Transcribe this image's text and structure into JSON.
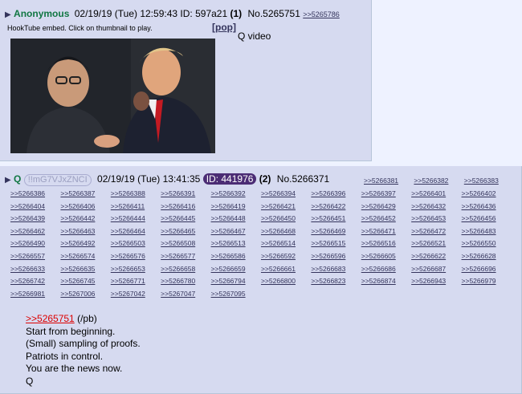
{
  "post1": {
    "name": "Anonymous",
    "date": "02/19/19 (Tue) 12:59:43",
    "id_label": "ID:",
    "id_value": "597a21",
    "id_count": "(1)",
    "number": "No.5265751",
    "reply_link": ">>5265786",
    "embed_note": "HookTube embed. Click on thumbnail to play.",
    "pop_label": "[pop]",
    "video_label": "Q video"
  },
  "post2": {
    "name": "Q",
    "tripcode": "!!mG7VJxZNCI",
    "date": "02/19/19 (Tue) 13:41:35",
    "id_badge": "ID: 441976",
    "id_count": "(2)",
    "number": "No.5266371",
    "first_row_links": [
      ">>5266381",
      ">>5266382",
      ">>5266383"
    ],
    "backlinks": [
      ">>5266386",
      ">>5266387",
      ">>5266388",
      ">>5266391",
      ">>5266392",
      ">>5266394",
      ">>5266396",
      ">>5266397",
      ">>5266401",
      ">>5266402",
      ">>5266404",
      ">>5266406",
      ">>5266411",
      ">>5266416",
      ">>5266419",
      ">>5266421",
      ">>5266422",
      ">>5266429",
      ">>5266432",
      ">>5266436",
      ">>5266439",
      ">>5266442",
      ">>5266444",
      ">>5266445",
      ">>5266448",
      ">>5266450",
      ">>5266451",
      ">>5266452",
      ">>5266453",
      ">>5266456",
      ">>5266462",
      ">>5266463",
      ">>5266464",
      ">>5266465",
      ">>5266467",
      ">>5266468",
      ">>5266469",
      ">>5266471",
      ">>5266472",
      ">>5266483",
      ">>5266490",
      ">>5266492",
      ">>5266503",
      ">>5266508",
      ">>5266513",
      ">>5266514",
      ">>5266515",
      ">>5266516",
      ">>5266521",
      ">>5266550",
      ">>5266557",
      ">>5266574",
      ">>5266576",
      ">>5266577",
      ">>5266586",
      ">>5266592",
      ">>5266596",
      ">>5266605",
      ">>5266622",
      ">>5266628",
      ">>5266633",
      ">>5266635",
      ">>5266653",
      ">>5266658",
      ">>5266659",
      ">>5266661",
      ">>5266683",
      ">>5266686",
      ">>5266687",
      ">>5266696",
      ">>5266742",
      ">>5266745",
      ">>5266771",
      ">>5266780",
      ">>5266794",
      ">>5266800",
      ">>5266823",
      ">>5266874",
      ">>5266943",
      ">>5266979",
      ">>5266981",
      ">>5267006",
      ">>5267042",
      ">>5267047",
      ">>5267095"
    ],
    "quote_link": ">>5265751",
    "quote_suffix": " (/pb)",
    "lines": [
      "Start from beginning.",
      "(Small) sampling of proofs.",
      "Patriots in control.",
      "You are the news now.",
      "Q"
    ]
  }
}
